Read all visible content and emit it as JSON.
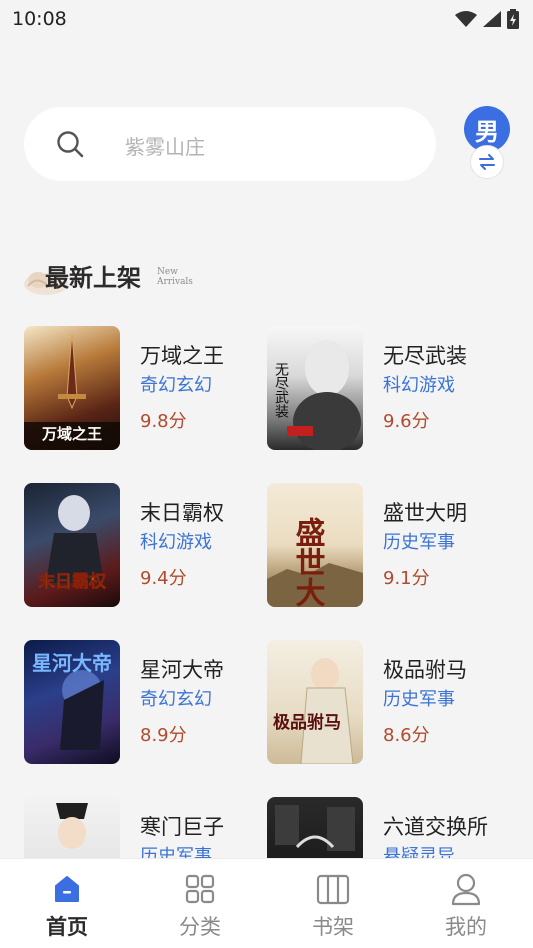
{
  "status_bar": {
    "time": "10:08"
  },
  "search": {
    "placeholder": "紫雾山庄"
  },
  "gender": {
    "label": "男"
  },
  "section": {
    "title": "最新上架",
    "subtitle_line1": "New",
    "subtitle_line2": "Arrivals"
  },
  "books": [
    {
      "title": "万域之王",
      "genre": "奇幻玄幻",
      "score": "9.8分",
      "cover_text": "万域之王"
    },
    {
      "title": "无尽武装",
      "genre": "科幻游戏",
      "score": "9.6分",
      "cover_text": "无尽武装"
    },
    {
      "title": "末日霸权",
      "genre": "科幻游戏",
      "score": "9.4分",
      "cover_text": "末日霸权"
    },
    {
      "title": "盛世大明",
      "genre": "历史军事",
      "score": "9.1分",
      "cover_text": "盛世大明"
    },
    {
      "title": "星河大帝",
      "genre": "奇幻玄幻",
      "score": "8.9分",
      "cover_text": "星河大帝"
    },
    {
      "title": "极品驸马",
      "genre": "历史军事",
      "score": "8.6分",
      "cover_text": "极品驸马"
    },
    {
      "title": "寒门巨子",
      "genre": "历史军事",
      "score": "",
      "cover_text": ""
    },
    {
      "title": "六道交换所",
      "genre": "悬疑灵异",
      "score": "",
      "cover_text": ""
    }
  ],
  "tabs": [
    {
      "label": "首页",
      "icon": "home-icon",
      "active": true
    },
    {
      "label": "分类",
      "icon": "grid-icon",
      "active": false
    },
    {
      "label": "书架",
      "icon": "bookshelf-icon",
      "active": false
    },
    {
      "label": "我的",
      "icon": "user-icon",
      "active": false
    }
  ],
  "colors": {
    "accent": "#3b6ee0",
    "genre": "#3b74d6",
    "score": "#b04b2d"
  }
}
